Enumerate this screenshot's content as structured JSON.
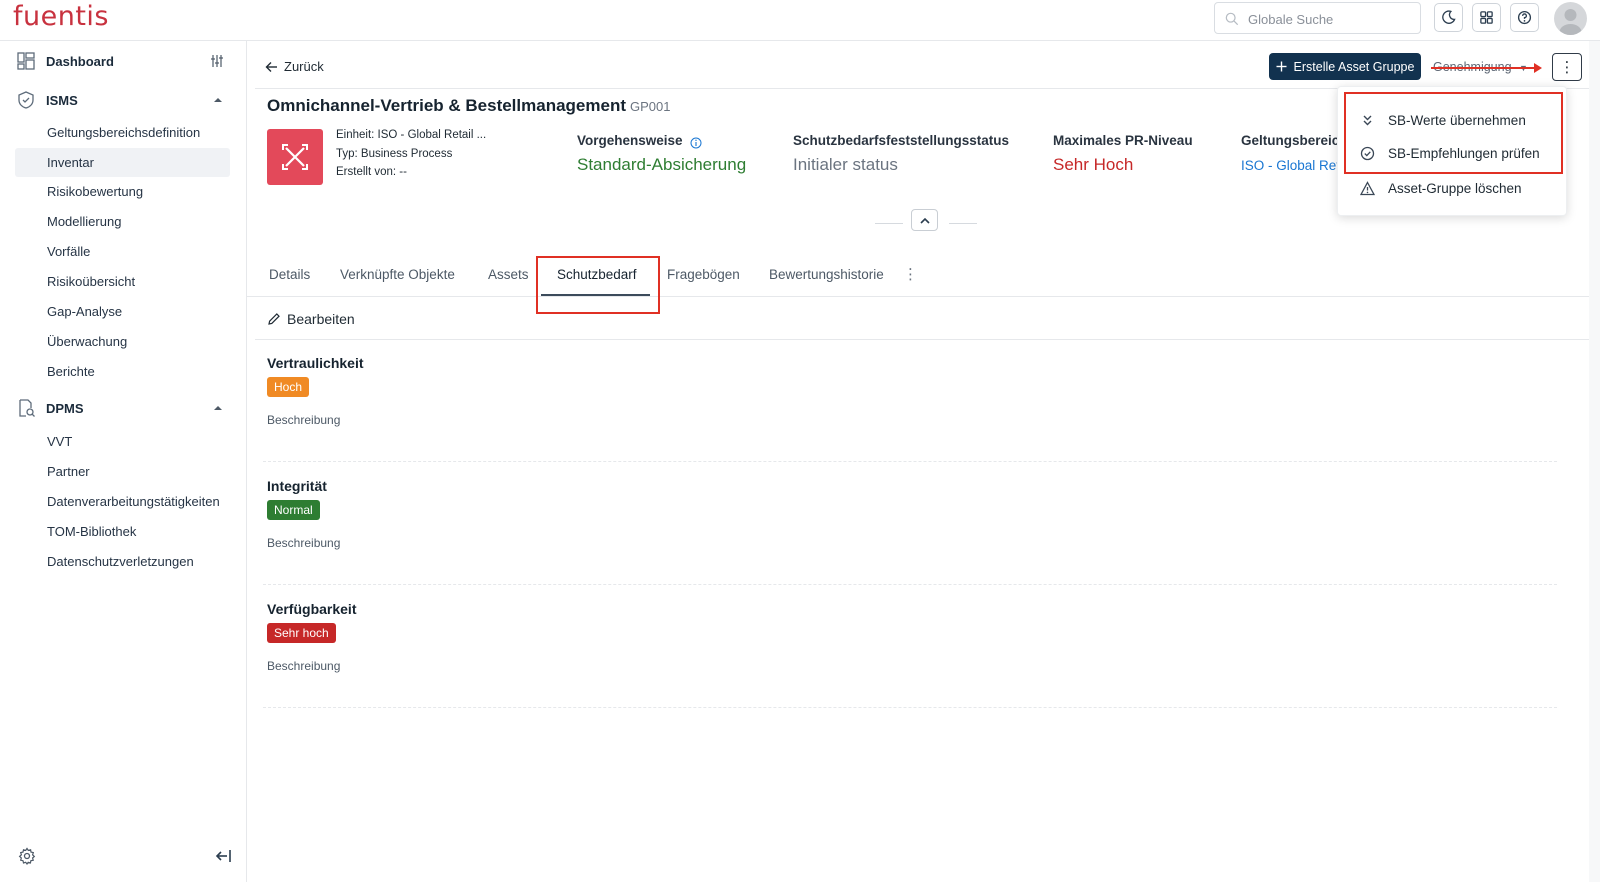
{
  "header": {
    "logo": "fuentis",
    "search_placeholder": "Globale Suche"
  },
  "sidebar": {
    "dashboard": "Dashboard",
    "isms": {
      "title": "ISMS",
      "items": [
        "Geltungsbereichsdefinition",
        "Inventar",
        "Risikobewertung",
        "Modellierung",
        "Vorfälle",
        "Risikoübersicht",
        "Gap-Analyse",
        "Überwachung",
        "Berichte"
      ],
      "active": "Inventar"
    },
    "dpms": {
      "title": "DPMS",
      "items": [
        "VVT",
        "Partner",
        "Datenverarbeitungstätigkeiten",
        "TOM-Bibliothek",
        "Datenschutzverletzungen"
      ]
    }
  },
  "toolbar": {
    "back": "Zurück",
    "create": "Erstelle Asset Gruppe",
    "approval": "Genehmigung"
  },
  "asset": {
    "title": "Omnichannel-Vertrieb & Bestellmanagement",
    "code": "GP001",
    "unit": "Einheit: ISO - Global Retail ...",
    "type": "Typ: Business Process",
    "created_by": "Erstellt von: --",
    "approach_label": "Vorgehensweise",
    "approach_value": "Standard-Absicherung",
    "status_label": "Schutzbedarfsfeststellungsstatus",
    "status_value": "Initialer status",
    "pr_label": "Maximales PR-Niveau",
    "pr_value": "Sehr Hoch",
    "scope_label": "Geltungsbereich",
    "scope_value": "ISO - Global Retail"
  },
  "tabs": [
    "Details",
    "Verknüpfte Objekte",
    "Assets",
    "Schutzbedarf",
    "Fragebögen",
    "Bewertungshistorie"
  ],
  "active_tab": "Schutzbedarf",
  "content": {
    "edit": "Bearbeiten",
    "sections": [
      {
        "name": "Vertraulichkeit",
        "level": "Hoch",
        "color": "#f08a24",
        "desc": "Beschreibung"
      },
      {
        "name": "Integrität",
        "level": "Normal",
        "color": "#2e7d32",
        "desc": "Beschreibung"
      },
      {
        "name": "Verfügbarkeit",
        "level": "Sehr hoch",
        "color": "#c62828",
        "desc": "Beschreibung"
      }
    ]
  },
  "menu": {
    "items": [
      "SB-Werte übernehmen",
      "SB-Empfehlungen prüfen",
      "Asset-Gruppe löschen"
    ]
  },
  "colors": {
    "brand": "#c8323f",
    "primary": "#12324f",
    "green": "#2e7d32",
    "red": "#c62828",
    "link": "#1976d2",
    "highlight": "#e03024"
  }
}
